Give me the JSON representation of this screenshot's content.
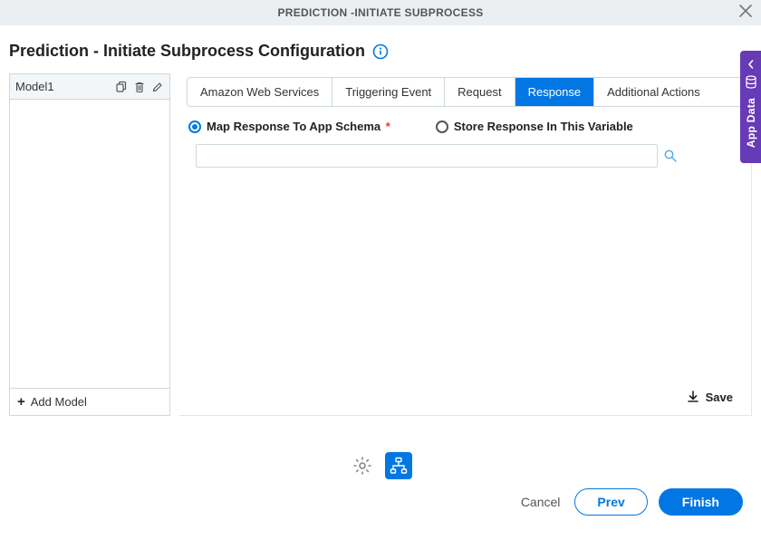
{
  "header": {
    "title": "PREDICTION -INITIATE SUBPROCESS"
  },
  "page": {
    "title": "Prediction - Initiate Subprocess Configuration"
  },
  "side_tab": {
    "label": "App Data"
  },
  "sidebar": {
    "model_name": "Model1",
    "add_label": "Add Model"
  },
  "tabs": {
    "t0": "Amazon Web Services",
    "t1": "Triggering Event",
    "t2": "Request",
    "t3": "Response",
    "t4": "Additional Actions",
    "active_index": 3
  },
  "radios": {
    "r0": "Map Response To App Schema",
    "r1": "Store Response In This Variable",
    "selected_index": 0
  },
  "input": {
    "schema_value": "",
    "schema_placeholder": ""
  },
  "actions": {
    "save": "Save",
    "cancel": "Cancel",
    "prev": "Prev",
    "finish": "Finish"
  }
}
